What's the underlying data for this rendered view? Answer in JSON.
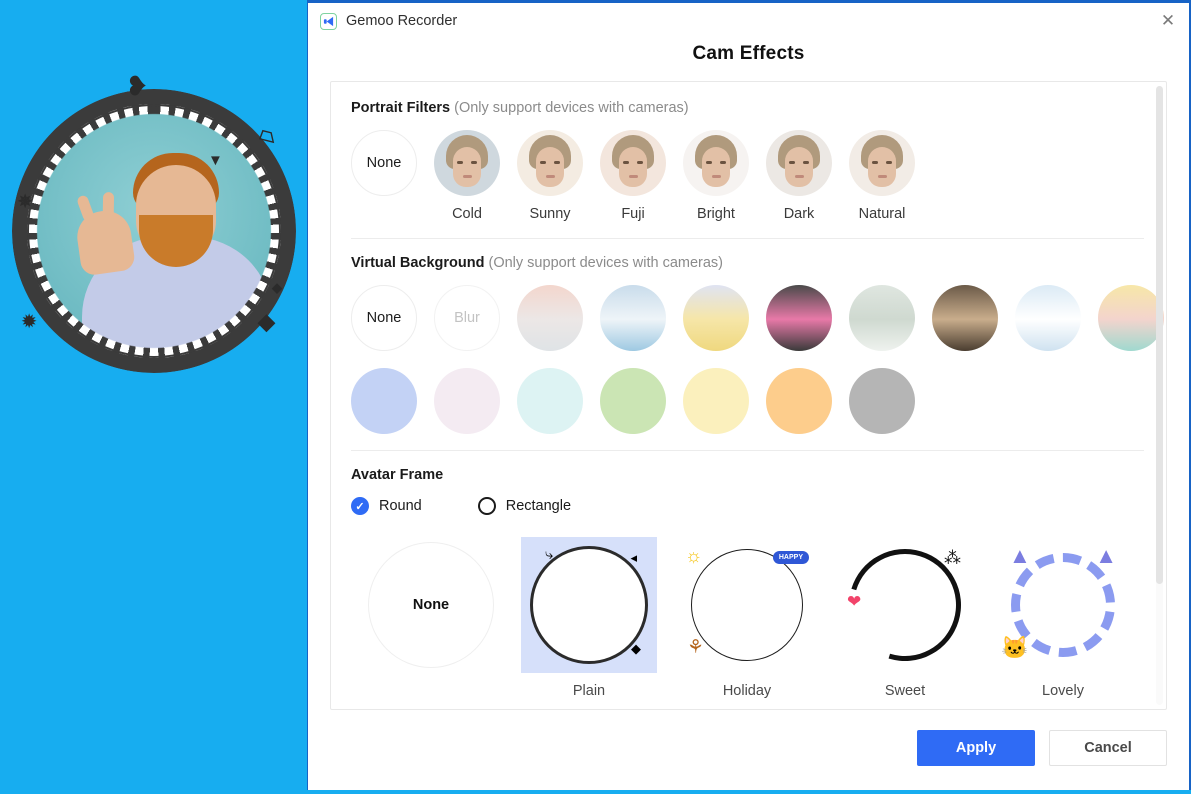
{
  "window": {
    "app_title": "Gemoo Recorder",
    "logo_icon": "gemoo-logo-icon",
    "close_icon": "close-icon",
    "close_glyph": "✕",
    "accent_color": "#2f6bf5",
    "border_color": "#1763c6",
    "backdrop_color": "#17adf0"
  },
  "dialog": {
    "heading": "Cam Effects"
  },
  "portrait_filters": {
    "title": "Portrait Filters",
    "hint": "(Only support devices with cameras)",
    "items": [
      {
        "label": "None",
        "kind": "none",
        "bg": "#ffffff",
        "tint": "none"
      },
      {
        "label": "Cold",
        "kind": "face",
        "bg": "#cfd8de",
        "tint": "cold"
      },
      {
        "label": "Sunny",
        "kind": "face",
        "bg": "#f4ece2",
        "tint": "sunny"
      },
      {
        "label": "Fuji",
        "kind": "face",
        "bg": "#f3e6dd",
        "tint": "fuji"
      },
      {
        "label": "Bright",
        "kind": "face",
        "bg": "#f6f3f1",
        "tint": "bright"
      },
      {
        "label": "Dark",
        "kind": "face",
        "bg": "#ece8e4",
        "tint": "dark"
      },
      {
        "label": "Natural",
        "kind": "face",
        "bg": "#f2ece6",
        "tint": "natural"
      }
    ]
  },
  "virtual_background": {
    "title": "Virtual Background",
    "hint": "(Only support devices with cameras)",
    "row1": [
      {
        "label": "None",
        "kind": "none",
        "name": "bg-none"
      },
      {
        "label": "Blur",
        "kind": "blur",
        "name": "bg-blur"
      },
      {
        "label": "",
        "kind": "image",
        "name": "bg-sunset-beach",
        "colors": [
          "#f3d6cd",
          "#ece7e6",
          "#dfe3e6"
        ]
      },
      {
        "label": "",
        "kind": "image",
        "name": "bg-ocean",
        "colors": [
          "#c9dceb",
          "#eef4f8",
          "#9ec9e2"
        ]
      },
      {
        "label": "",
        "kind": "image",
        "name": "bg-yellow-leaves",
        "colors": [
          "#dfe3f2",
          "#f6e6a8",
          "#efd87f"
        ]
      },
      {
        "label": "",
        "kind": "image",
        "name": "bg-mushrooms",
        "colors": [
          "#4a4a4a",
          "#e879a8",
          "#3a3a3a"
        ]
      },
      {
        "label": "",
        "kind": "image",
        "name": "bg-lamp-wall",
        "colors": [
          "#dfe6e0",
          "#cfd9d0",
          "#eef2ee"
        ]
      },
      {
        "label": "",
        "kind": "image",
        "name": "bg-bookshelf",
        "colors": [
          "#6b5a48",
          "#c9ad8c",
          "#4a3d30"
        ]
      },
      {
        "label": "",
        "kind": "image",
        "name": "bg-snow-mountain",
        "colors": [
          "#dbeaf5",
          "#ffffff",
          "#cfe2f0"
        ]
      },
      {
        "label": "",
        "kind": "image",
        "name": "bg-abstract-art",
        "colors": [
          "#f7e7a8",
          "#f3d4cd",
          "#9fd9cf"
        ]
      }
    ],
    "row2": [
      {
        "label": "",
        "kind": "solid",
        "name": "bg-color-periwinkle",
        "color": "#c3d2f5"
      },
      {
        "label": "",
        "kind": "solid",
        "name": "bg-color-pink",
        "color": "#f4ebf2"
      },
      {
        "label": "",
        "kind": "solid",
        "name": "bg-color-aqua",
        "color": "#ddf3f3"
      },
      {
        "label": "",
        "kind": "solid",
        "name": "bg-color-green",
        "color": "#cbe5b4"
      },
      {
        "label": "",
        "kind": "solid",
        "name": "bg-color-cream",
        "color": "#fbf0bd"
      },
      {
        "label": "",
        "kind": "solid",
        "name": "bg-color-orange",
        "color": "#fdcd8c"
      },
      {
        "label": "",
        "kind": "solid",
        "name": "bg-color-gray",
        "color": "#b5b5b5"
      }
    ]
  },
  "avatar_frame": {
    "title": "Avatar Frame",
    "shape_options": [
      {
        "label": "Round",
        "selected": true,
        "check_glyph": "✓"
      },
      {
        "label": "Rectangle",
        "selected": false,
        "check_glyph": ""
      }
    ],
    "frames": [
      {
        "label": "",
        "name": "frame-none",
        "inner_text": "None",
        "selected": false
      },
      {
        "label": "Plain",
        "name": "frame-plain",
        "inner_text": "",
        "selected": true
      },
      {
        "label": "Holiday",
        "name": "frame-holiday",
        "inner_text": "",
        "selected": false,
        "badge": "HAPPY"
      },
      {
        "label": "Sweet",
        "name": "frame-sweet",
        "inner_text": "",
        "selected": false
      },
      {
        "label": "Lovely",
        "name": "frame-lovely",
        "inner_text": "",
        "selected": false
      }
    ]
  },
  "footer": {
    "apply_label": "Apply",
    "cancel_label": "Cancel"
  }
}
